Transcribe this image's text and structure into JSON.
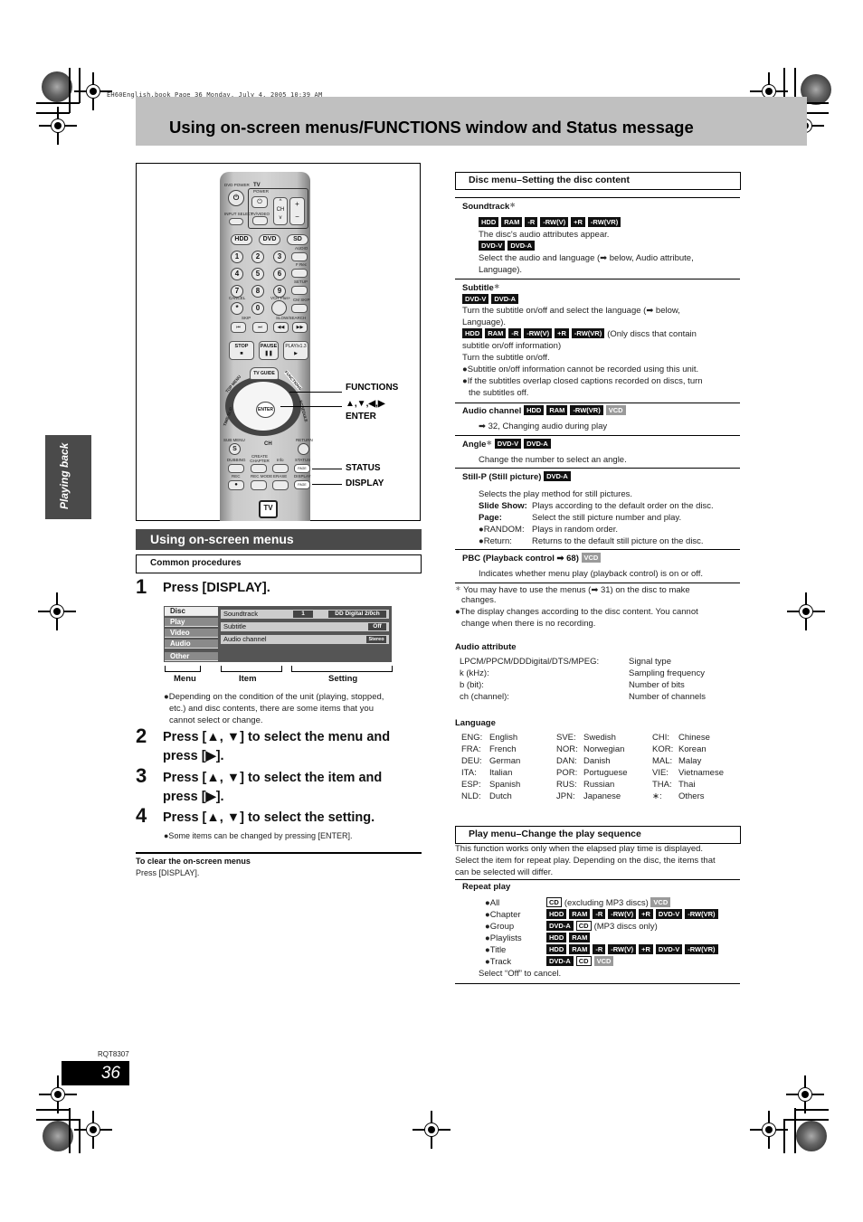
{
  "book_line": "EH60English.book  Page 36  Monday, July 4, 2005  10:39 AM",
  "page_title": "Using on-screen menus/FUNCTIONS window and Status message",
  "side_tab": "Playing back",
  "remote": {
    "labels": {
      "dvd_power": "DVD POWER",
      "tv": "TV",
      "power": "POWER",
      "input_select": "INPUT SELECT",
      "tv_video": "TV/VIDEO",
      "ch": "CH",
      "volume": "VOLUME",
      "hdd": "HDD",
      "dvd": "DVD",
      "sd": "SD",
      "audio": "AUDIO",
      "f_rec": "F Rec",
      "setup": "SETUP",
      "cancel": "CANCEL",
      "vcr_plus": "VCR Plus+",
      "cm_skip": "CM SKIP",
      "skip": "SKIP",
      "slow_search": "SLOW/SEARCH",
      "stop": "STOP",
      "pause": "PAUSE",
      "play": "PLAY/x1.3",
      "tv_guide": "TV GUIDE",
      "top_menu": "TOP MENU",
      "direct_navigator": "DIRECT NAVIGATOR",
      "functions": "FUNCTIONS",
      "time_slip": "TIME SLIP",
      "schedule": "SCHEDULE",
      "enter": "ENTER",
      "sub_menu": "SUB MENU",
      "return": "RETURN",
      "dubbing": "DUBBING",
      "create_chapter": "CREATE CHAPTER",
      "info": "Info",
      "status": "STATUS",
      "rec": "REC",
      "rec_mode": "REC MODE",
      "erase": "ERASE",
      "display": "DISPLAY",
      "page_up": "PAGE",
      "page_down": "PAGE",
      "tv_logo": "TV"
    },
    "numbers": [
      "1",
      "2",
      "3",
      "4",
      "5",
      "6",
      "7",
      "8",
      "9",
      "*",
      "0"
    ],
    "callouts": {
      "functions": "FUNCTIONS",
      "arrows": "▲,▼,◀,▶",
      "enter": "ENTER",
      "status": "STATUS",
      "display": "DISPLAY"
    }
  },
  "left": {
    "section_title": "Using on-screen menus",
    "sub_title": "Common procedures",
    "steps": [
      {
        "num": "1",
        "text": "Press [DISPLAY]."
      },
      {
        "num": "2",
        "text": "Press [▲, ▼] to select the menu and",
        "text2": "press [▶]."
      },
      {
        "num": "3",
        "text": "Press [▲, ▼] to select the item and",
        "text2": "press [▶]."
      },
      {
        "num": "4",
        "text": "Press [▲, ▼] to select the setting."
      }
    ],
    "osd": {
      "menus": [
        "Disc",
        "Play",
        "Video",
        "Audio",
        "Other"
      ],
      "items": [
        {
          "label": "Soundtrack",
          "value1": "1",
          "value2": "DD Digital  2/0ch"
        },
        {
          "label": "Subtitle",
          "value": "Off"
        },
        {
          "label": "Audio channel",
          "value": "Stereo"
        }
      ],
      "bracket_labels": [
        "Menu",
        "Item",
        "Setting"
      ]
    },
    "note1": [
      "●Depending on the condition of the unit (playing, stopped,",
      "etc.) and disc contents, there are some items that you",
      "cannot select or change."
    ],
    "note4": "●Some items can be changed by pressing [ENTER].",
    "clear_title": "To clear the on-screen menus",
    "clear_text": "Press [DISPLAY]."
  },
  "right": {
    "disc_menu_title": "Disc menu–Setting the disc content",
    "soundtrack": {
      "title": "Soundtrack",
      "badges1": [
        "HDD",
        "RAM",
        "-R",
        "-RW(V)",
        "+R",
        "-RW(VR)"
      ],
      "text1": "The disc's audio attributes appear.",
      "badges2": [
        "DVD-V",
        "DVD-A"
      ],
      "text2a": "Select the audio and language (➡ below, Audio attribute,",
      "text2b": "Language)."
    },
    "subtitle": {
      "title": "Subtitle",
      "badges1": [
        "DVD-V",
        "DVD-A"
      ],
      "text1a": "Turn the subtitle on/off and select the language (➡ below,",
      "text1b": "Language).",
      "badges2": [
        "HDD",
        "RAM",
        "-R",
        "-RW(V)",
        "+R",
        "-RW(VR)"
      ],
      "text2a": "(Only discs that contain",
      "text2b": "subtitle on/off information)",
      "text3": "Turn the subtitle on/off.",
      "bullet1": "●Subtitle on/off information cannot be recorded using this unit.",
      "bullet2a": "●If the subtitles overlap closed captions recorded on discs, turn",
      "bullet2b": "the subtitles off."
    },
    "audio_channel": {
      "title": "Audio channel",
      "badges": [
        "HDD",
        "RAM",
        "-RW(VR)"
      ],
      "badge_vcd": "VCD",
      "text": "➡ 32, Changing audio during play"
    },
    "angle": {
      "title": "Angle",
      "badges": [
        "DVD-V",
        "DVD-A"
      ],
      "text": "Change the number to select an angle."
    },
    "still_p": {
      "title": "Still-P (Still picture)",
      "badge": "DVD-A",
      "text": "Selects the play method for still pictures.",
      "rows": [
        {
          "k": "Slide Show:",
          "v": "Plays according to the default order on the disc."
        },
        {
          "k": "Page:",
          "v": "Select the still picture number and play."
        },
        {
          "k": "●RANDOM:",
          "v": "Plays in random order."
        },
        {
          "k": "●Return:",
          "v": "Returns to the default still picture on the disc."
        }
      ]
    },
    "pbc": {
      "title": "PBC (Playback control ➡ 68)",
      "badge_vcd": "VCD",
      "text": "Indicates whether menu play (playback control) is on or off."
    },
    "footnote_a": "You may have to use the menus (➡ 31) on the disc to make",
    "footnote_b": "changes.",
    "footnote2_a": "●The display changes according to the disc content. You cannot",
    "footnote2_b": "change when there is no recording.",
    "audio_attribute": {
      "title": "Audio attribute",
      "rows": [
        {
          "k": "LPCM/PPCM/DDDigital/DTS/MPEG:",
          "v": "Signal type"
        },
        {
          "k": "k (kHz):",
          "v": "Sampling frequency"
        },
        {
          "k": "b (bit):",
          "v": "Number of bits"
        },
        {
          "k": "ch (channel):",
          "v": "Number of channels"
        }
      ]
    },
    "language": {
      "title": "Language",
      "columns": [
        [
          {
            "k": "ENG:",
            "v": "English"
          },
          {
            "k": "FRA:",
            "v": "French"
          },
          {
            "k": "DEU:",
            "v": "German"
          },
          {
            "k": "ITA:",
            "v": "Italian"
          },
          {
            "k": "ESP:",
            "v": "Spanish"
          },
          {
            "k": "NLD:",
            "v": "Dutch"
          }
        ],
        [
          {
            "k": "SVE:",
            "v": "Swedish"
          },
          {
            "k": "NOR:",
            "v": "Norwegian"
          },
          {
            "k": "DAN:",
            "v": "Danish"
          },
          {
            "k": "POR:",
            "v": "Portuguese"
          },
          {
            "k": "RUS:",
            "v": "Russian"
          },
          {
            "k": "JPN:",
            "v": "Japanese"
          }
        ],
        [
          {
            "k": "CHI:",
            "v": "Chinese"
          },
          {
            "k": "KOR:",
            "v": "Korean"
          },
          {
            "k": "MAL:",
            "v": "Malay"
          },
          {
            "k": "VIE:",
            "v": "Vietnamese"
          },
          {
            "k": "THA:",
            "v": "Thai"
          },
          {
            "k": "∗:",
            "v": "Others"
          }
        ]
      ]
    },
    "play_menu_title": "Play menu–Change the play sequence",
    "play_menu_text": [
      "This function works only when the elapsed play time is displayed.",
      "Select the item for repeat play. Depending on the disc, the items that",
      "can be selected will differ."
    ],
    "repeat_play": {
      "title": "Repeat play",
      "rows": [
        {
          "label": "●All",
          "badges": [
            {
              "t": "CD",
              "k": "cd"
            }
          ],
          "after": "(excluding MP3 discs)",
          "tail": [
            {
              "t": "VCD",
              "k": "vcd"
            }
          ]
        },
        {
          "label": "●Chapter",
          "badges": [
            {
              "t": "HDD"
            },
            {
              "t": "RAM"
            },
            {
              "t": "-R"
            },
            {
              "t": "-RW(V)"
            },
            {
              "t": "+R"
            },
            {
              "t": "DVD-V"
            },
            {
              "t": "-RW(VR)"
            }
          ]
        },
        {
          "label": "●Group",
          "badges": [
            {
              "t": "DVD-A"
            },
            {
              "t": "CD",
              "k": "cd"
            }
          ],
          "after": "(MP3 discs only)"
        },
        {
          "label": "●Playlists",
          "badges": [
            {
              "t": "HDD"
            },
            {
              "t": "RAM"
            }
          ]
        },
        {
          "label": "●Title",
          "badges": [
            {
              "t": "HDD"
            },
            {
              "t": "RAM"
            },
            {
              "t": "-R"
            },
            {
              "t": "-RW(V)"
            },
            {
              "t": "+R"
            },
            {
              "t": "DVD-V"
            },
            {
              "t": "-RW(VR)"
            }
          ]
        },
        {
          "label": "●Track",
          "badges": [
            {
              "t": "DVD-A"
            },
            {
              "t": "CD",
              "k": "cd"
            },
            {
              "t": "VCD",
              "k": "vcd"
            }
          ]
        }
      ],
      "cancel_text": "Select “Off” to cancel."
    }
  },
  "footer": {
    "code": "RQT8307",
    "page_number": "36"
  }
}
